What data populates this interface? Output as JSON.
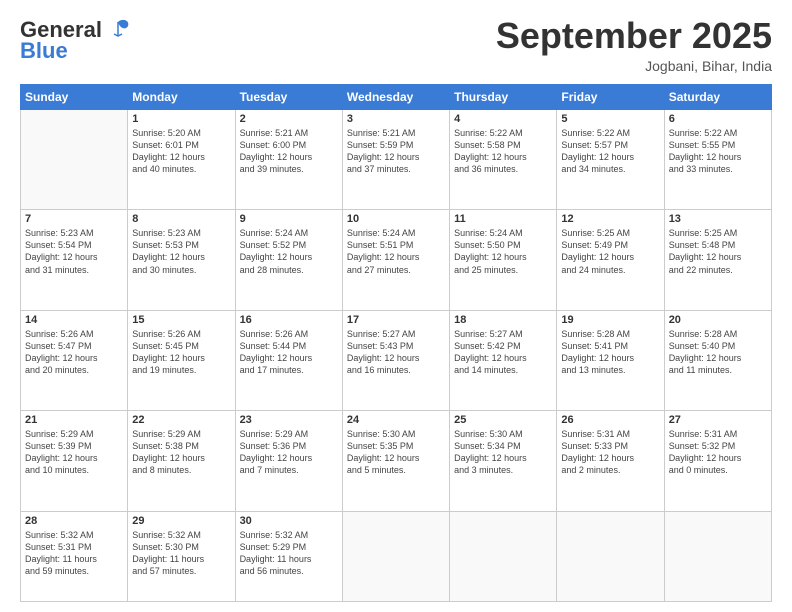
{
  "header": {
    "logo_line1": "General",
    "logo_line2": "Blue",
    "month": "September 2025",
    "location": "Jogbani, Bihar, India"
  },
  "days_of_week": [
    "Sunday",
    "Monday",
    "Tuesday",
    "Wednesday",
    "Thursday",
    "Friday",
    "Saturday"
  ],
  "weeks": [
    [
      {
        "day": "",
        "info": ""
      },
      {
        "day": "1",
        "info": "Sunrise: 5:20 AM\nSunset: 6:01 PM\nDaylight: 12 hours\nand 40 minutes."
      },
      {
        "day": "2",
        "info": "Sunrise: 5:21 AM\nSunset: 6:00 PM\nDaylight: 12 hours\nand 39 minutes."
      },
      {
        "day": "3",
        "info": "Sunrise: 5:21 AM\nSunset: 5:59 PM\nDaylight: 12 hours\nand 37 minutes."
      },
      {
        "day": "4",
        "info": "Sunrise: 5:22 AM\nSunset: 5:58 PM\nDaylight: 12 hours\nand 36 minutes."
      },
      {
        "day": "5",
        "info": "Sunrise: 5:22 AM\nSunset: 5:57 PM\nDaylight: 12 hours\nand 34 minutes."
      },
      {
        "day": "6",
        "info": "Sunrise: 5:22 AM\nSunset: 5:55 PM\nDaylight: 12 hours\nand 33 minutes."
      }
    ],
    [
      {
        "day": "7",
        "info": "Sunrise: 5:23 AM\nSunset: 5:54 PM\nDaylight: 12 hours\nand 31 minutes."
      },
      {
        "day": "8",
        "info": "Sunrise: 5:23 AM\nSunset: 5:53 PM\nDaylight: 12 hours\nand 30 minutes."
      },
      {
        "day": "9",
        "info": "Sunrise: 5:24 AM\nSunset: 5:52 PM\nDaylight: 12 hours\nand 28 minutes."
      },
      {
        "day": "10",
        "info": "Sunrise: 5:24 AM\nSunset: 5:51 PM\nDaylight: 12 hours\nand 27 minutes."
      },
      {
        "day": "11",
        "info": "Sunrise: 5:24 AM\nSunset: 5:50 PM\nDaylight: 12 hours\nand 25 minutes."
      },
      {
        "day": "12",
        "info": "Sunrise: 5:25 AM\nSunset: 5:49 PM\nDaylight: 12 hours\nand 24 minutes."
      },
      {
        "day": "13",
        "info": "Sunrise: 5:25 AM\nSunset: 5:48 PM\nDaylight: 12 hours\nand 22 minutes."
      }
    ],
    [
      {
        "day": "14",
        "info": "Sunrise: 5:26 AM\nSunset: 5:47 PM\nDaylight: 12 hours\nand 20 minutes."
      },
      {
        "day": "15",
        "info": "Sunrise: 5:26 AM\nSunset: 5:45 PM\nDaylight: 12 hours\nand 19 minutes."
      },
      {
        "day": "16",
        "info": "Sunrise: 5:26 AM\nSunset: 5:44 PM\nDaylight: 12 hours\nand 17 minutes."
      },
      {
        "day": "17",
        "info": "Sunrise: 5:27 AM\nSunset: 5:43 PM\nDaylight: 12 hours\nand 16 minutes."
      },
      {
        "day": "18",
        "info": "Sunrise: 5:27 AM\nSunset: 5:42 PM\nDaylight: 12 hours\nand 14 minutes."
      },
      {
        "day": "19",
        "info": "Sunrise: 5:28 AM\nSunset: 5:41 PM\nDaylight: 12 hours\nand 13 minutes."
      },
      {
        "day": "20",
        "info": "Sunrise: 5:28 AM\nSunset: 5:40 PM\nDaylight: 12 hours\nand 11 minutes."
      }
    ],
    [
      {
        "day": "21",
        "info": "Sunrise: 5:29 AM\nSunset: 5:39 PM\nDaylight: 12 hours\nand 10 minutes."
      },
      {
        "day": "22",
        "info": "Sunrise: 5:29 AM\nSunset: 5:38 PM\nDaylight: 12 hours\nand 8 minutes."
      },
      {
        "day": "23",
        "info": "Sunrise: 5:29 AM\nSunset: 5:36 PM\nDaylight: 12 hours\nand 7 minutes."
      },
      {
        "day": "24",
        "info": "Sunrise: 5:30 AM\nSunset: 5:35 PM\nDaylight: 12 hours\nand 5 minutes."
      },
      {
        "day": "25",
        "info": "Sunrise: 5:30 AM\nSunset: 5:34 PM\nDaylight: 12 hours\nand 3 minutes."
      },
      {
        "day": "26",
        "info": "Sunrise: 5:31 AM\nSunset: 5:33 PM\nDaylight: 12 hours\nand 2 minutes."
      },
      {
        "day": "27",
        "info": "Sunrise: 5:31 AM\nSunset: 5:32 PM\nDaylight: 12 hours\nand 0 minutes."
      }
    ],
    [
      {
        "day": "28",
        "info": "Sunrise: 5:32 AM\nSunset: 5:31 PM\nDaylight: 11 hours\nand 59 minutes."
      },
      {
        "day": "29",
        "info": "Sunrise: 5:32 AM\nSunset: 5:30 PM\nDaylight: 11 hours\nand 57 minutes."
      },
      {
        "day": "30",
        "info": "Sunrise: 5:32 AM\nSunset: 5:29 PM\nDaylight: 11 hours\nand 56 minutes."
      },
      {
        "day": "",
        "info": ""
      },
      {
        "day": "",
        "info": ""
      },
      {
        "day": "",
        "info": ""
      },
      {
        "day": "",
        "info": ""
      }
    ]
  ]
}
